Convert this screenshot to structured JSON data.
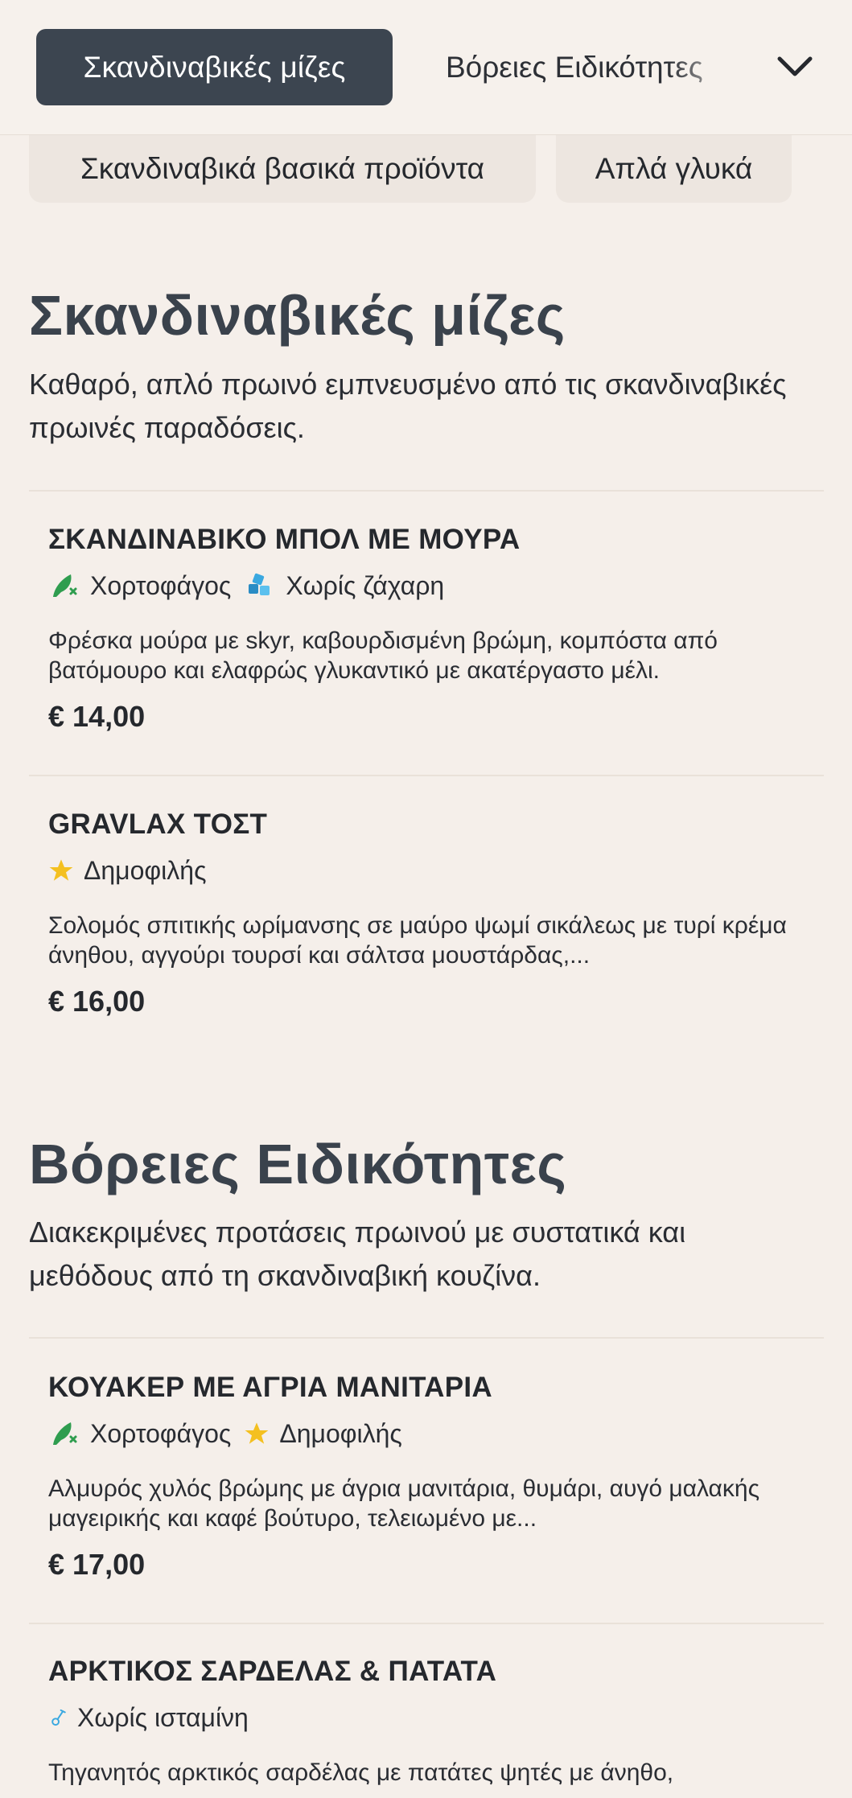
{
  "nav": {
    "active_tab": "Σκανδιναβικές μίζες",
    "next_tab": "Βόρειες Ειδικότητες",
    "chips": [
      "Σκανδιναβικά βασικά προϊόντα",
      "Απλά γλυκά"
    ],
    "more_icon": "chevron-down-icon"
  },
  "sections": [
    {
      "title": "Σκανδιναβικές μίζες",
      "description": "Καθαρό, απλό πρωινό εμπνευσμένο από τις σκανδιναβικές πρωινές παραδόσεις.",
      "items": [
        {
          "name": "ΣΚΑΝΔΙΝΑΒΙΚΟ ΜΠΟΛ ΜΕ ΜΟΥΡΑ",
          "tags": [
            {
              "label": "Χορτοφάγος",
              "icon": "vegetarian-icon"
            },
            {
              "label": "Χωρίς ζάχαρη",
              "icon": "sugar-free-icon"
            }
          ],
          "description": "Φρέσκα μούρα με skyr, καβουρδισμένη βρώμη, κομπόστα από βατόμουρο και ελαφρώς γλυκαντικό με ακατέργαστο μέλι.",
          "price": "€ 14,00"
        },
        {
          "name": "GRAVLAX ΤΟΣΤ",
          "tags": [
            {
              "label": "Δημοφιλής",
              "icon": "star-icon"
            }
          ],
          "description": "Σολομός σπιτικής ωρίμανσης σε μαύρο ψωμί σικάλεως με τυρί κρέμα άνηθου, αγγούρι τουρσί και σάλτσα μουστάρδας,...",
          "price": "€ 16,00"
        }
      ]
    },
    {
      "title": "Βόρειες Ειδικότητες",
      "description": "Διακεκριμένες προτάσεις πρωινού με συστατικά και μεθόδους από τη σκανδιναβική κουζίνα.",
      "items": [
        {
          "name": "ΚΟΥΑΚΕΡ ΜΕ ΑΓΡΙΑ ΜΑΝΙΤΑΡΙΑ",
          "tags": [
            {
              "label": "Χορτοφάγος",
              "icon": "vegetarian-icon"
            },
            {
              "label": "Δημοφιλής",
              "icon": "star-icon"
            }
          ],
          "description": "Αλμυρός χυλός βρώμης με άγρια μανιτάρια, θυμάρι, αυγό μαλακής μαγειρικής και καφέ βούτυρο, τελειωμένο με...",
          "price": "€ 17,00"
        },
        {
          "name": "ΑΡΚΤΙΚΟΣ ΣΑΡΔΕΛΑΣ & ΠΑΤΑΤΑ",
          "tags": [
            {
              "label": "Χωρίς ισταμίνη",
              "icon": "histamine-free-icon"
            }
          ],
          "description": "Τηγανητός αρκτικός σαρδέλας με πατάτες ψητές με άνηθο,",
          "price": ""
        }
      ]
    }
  ],
  "colors": {
    "background": "#f5efea",
    "active_tab_bg": "#3c4550",
    "heading": "#3a424c",
    "veg_green": "#2f9d4f",
    "star_yellow": "#f4c020",
    "sugar_blue": "#3aa8e0"
  }
}
